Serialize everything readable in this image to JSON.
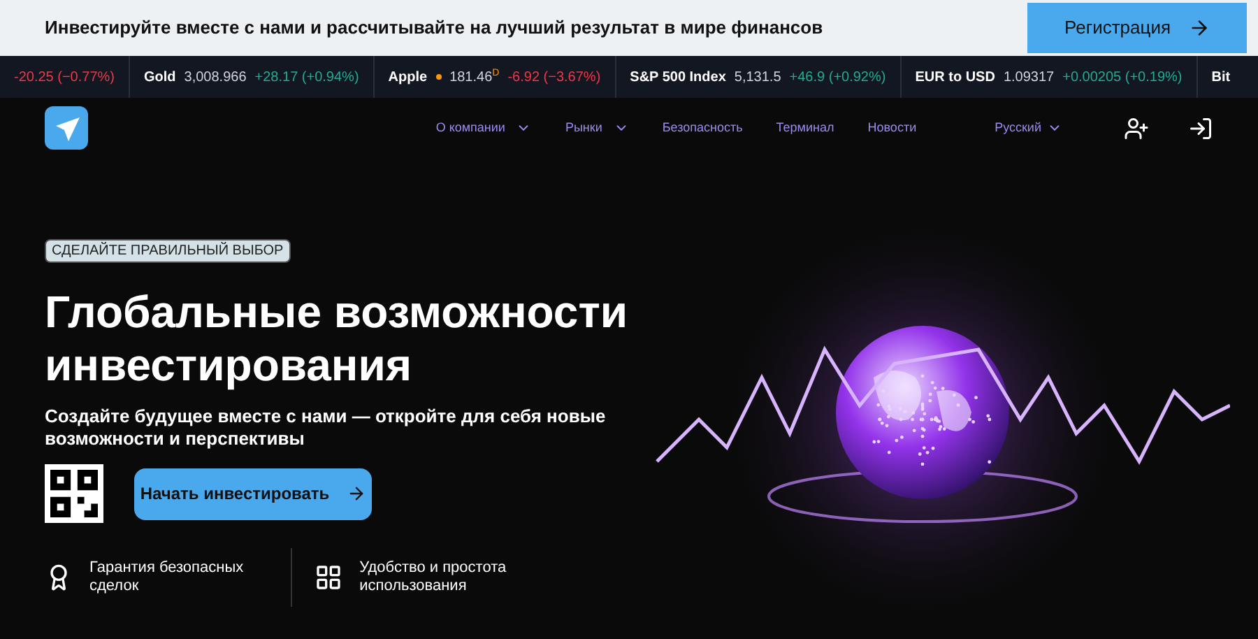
{
  "banner": {
    "text": "Инвестируйте вместе с нами и рассчитывайте на лучший результат в мире финансов",
    "button": "Регистрация"
  },
  "ticker": [
    {
      "change": "-20.25 (−0.77%)",
      "color": "#f23645",
      "dot": false
    },
    {
      "name": "Gold",
      "price": "3,008.966",
      "change": "+28.17 (+0.94%)",
      "color": "#22ab94",
      "dot": false
    },
    {
      "name": "Apple",
      "price": "181.46",
      "flag": "D",
      "change": "-6.92 (−3.67%)",
      "color": "#f23645",
      "dot": true
    },
    {
      "name": "S&P 500 Index",
      "price": "5,131.5",
      "change": "+46.9 (+0.92%)",
      "color": "#22ab94",
      "dot": false
    },
    {
      "name": "EUR to USD",
      "price": "1.09317",
      "change": "+0.00205 (+0.19%)",
      "color": "#22ab94",
      "dot": false
    },
    {
      "name": "Bit",
      "dot": false
    }
  ],
  "nav": {
    "items": [
      {
        "label": "О компании",
        "dropdown": true
      },
      {
        "label": "Рынки",
        "dropdown": true
      },
      {
        "label": "Безопасность",
        "dropdown": false
      },
      {
        "label": "Терминал",
        "dropdown": false
      },
      {
        "label": "Новости",
        "dropdown": false
      }
    ],
    "language": "Русский"
  },
  "hero": {
    "tag": "СДЕЛАЙТЕ ПРАВИЛЬНЫЙ ВЫБОР",
    "title_lines": [
      "Глобальные возможности",
      "инвестирования"
    ],
    "subtitle": "Создайте будущее вместе с нами — откройте для себя новые возможности и перспективы",
    "button": "Начать инвестировать",
    "features": [
      {
        "kind": "award",
        "text_lines": [
          "Гарантия безопасных",
          "сделок"
        ]
      },
      {
        "kind": "grid",
        "text_lines": [
          "Удобство и простота",
          "использования"
        ]
      }
    ]
  }
}
